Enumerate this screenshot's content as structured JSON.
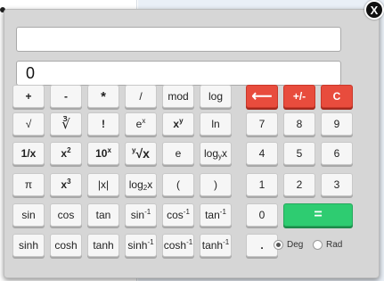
{
  "close_label": "X",
  "display": {
    "expression": "",
    "result": "0"
  },
  "keys": {
    "plus": "+",
    "minus": "-",
    "multiply": "*",
    "divide": "/",
    "mod": "mod",
    "log": "log",
    "backspace": "⟵",
    "plus_minus": "+/-",
    "clear": "C",
    "sqrt": "√",
    "cbrt": "∛",
    "factorial": "!",
    "exp_base": "e",
    "exp_sup": "x",
    "pow_base": "x",
    "pow_sup": "y",
    "ln": "ln",
    "d7": "7",
    "d8": "8",
    "d9": "9",
    "reciprocal": "1/x",
    "square_base": "x",
    "square_sup": "2",
    "tenpow_base": "10",
    "tenpow_sup": "x",
    "yroot": "√x",
    "yroot_sup": "y",
    "e": "e",
    "logyx_main": "log",
    "logyx_sub": "y",
    "logyx_tail": "x",
    "d4": "4",
    "d5": "5",
    "d6": "6",
    "pi": "π",
    "cube_base": "x",
    "cube_sup": "3",
    "abs": "|x|",
    "log2_main": "log",
    "log2_sub": "2",
    "log2_tail": "x",
    "lparen": "(",
    "rparen": ")",
    "d1": "1",
    "d2": "2",
    "d3": "3",
    "sin": "sin",
    "cos": "cos",
    "tan": "tan",
    "asin": "sin",
    "acos": "cos",
    "atan": "tan",
    "inv_sup": "-1",
    "d0": "0",
    "equals": "=",
    "sinh": "sinh",
    "cosh": "cosh",
    "tanh": "tanh",
    "asinh": "sinh",
    "acosh": "cosh",
    "atanh": "tanh",
    "dot": "."
  },
  "angle_mode": {
    "deg_label": "Deg",
    "rad_label": "Rad",
    "selected": "Deg"
  }
}
